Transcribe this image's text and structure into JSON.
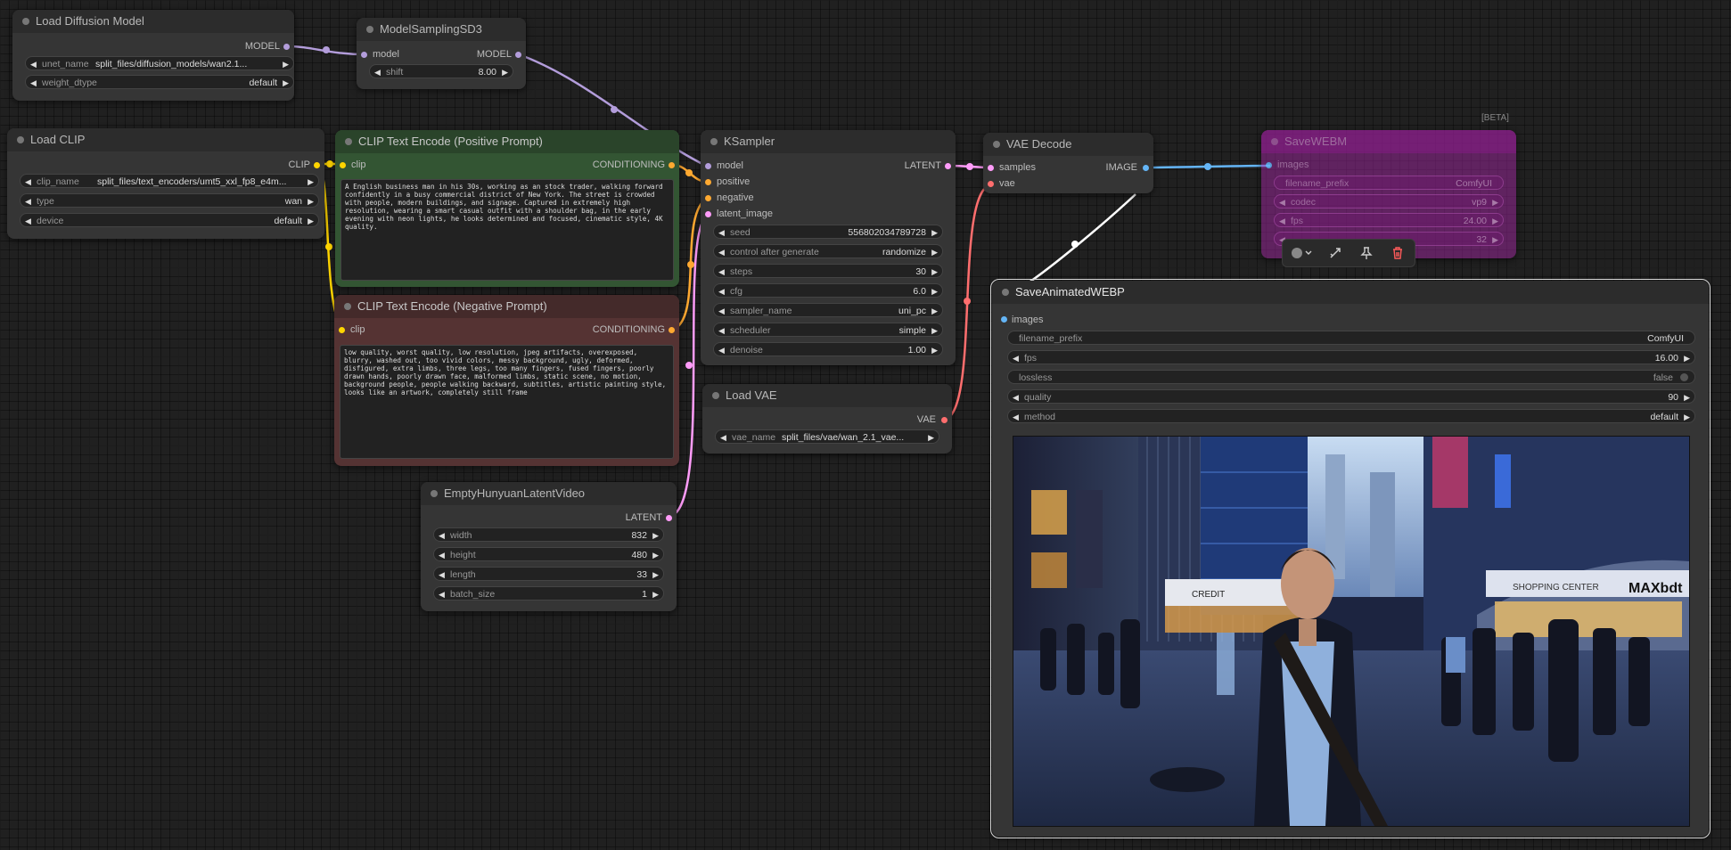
{
  "colors": {
    "model": "#b39ddb",
    "clip": "#ffd500",
    "conditioning": "#ffa931",
    "latent": "#ff9cf9",
    "vae": "#ff6e6e",
    "image": "#64b5f6"
  },
  "nodes": {
    "load_diffusion_model": {
      "title": "Load Diffusion Model",
      "out_model": "MODEL",
      "unet_name_label": "unet_name",
      "unet_name_value": "split_files/diffusion_models/wan2.1...",
      "weight_dtype_label": "weight_dtype",
      "weight_dtype_value": "default"
    },
    "model_sampling": {
      "title": "ModelSamplingSD3",
      "in_model": "model",
      "out_model": "MODEL",
      "shift_label": "shift",
      "shift_value": "8.00"
    },
    "load_clip": {
      "title": "Load CLIP",
      "out_clip": "CLIP",
      "clip_name_label": "clip_name",
      "clip_name_value": "split_files/text_encoders/umt5_xxl_fp8_e4m...",
      "type_label": "type",
      "type_value": "wan",
      "device_label": "device",
      "device_value": "default"
    },
    "clip_positive": {
      "title": "CLIP Text Encode (Positive Prompt)",
      "in_clip": "clip",
      "out": "CONDITIONING",
      "text": "A English business man in his 30s, working as an stock trader, walking forward confidently in a busy commercial district of New York. The street is crowded with people, modern buildings, and signage. Captured in extremely high resolution, wearing a smart casual outfit with a shoulder bag, in the early evening with neon lights, he looks determined and focused, cinematic style, 4K quality."
    },
    "clip_negative": {
      "title": "CLIP Text Encode (Negative Prompt)",
      "in_clip": "clip",
      "out": "CONDITIONING",
      "text": "low quality, worst quality, low resolution, jpeg artifacts, overexposed, blurry, washed out, too vivid colors, messy background, ugly, deformed, disfigured, extra limbs, three legs, too many fingers, fused fingers, poorly drawn hands, poorly drawn face, malformed limbs, static scene, no motion, background people, people walking backward, subtitles, artistic painting style, looks like an artwork, completely still frame"
    },
    "ksampler": {
      "title": "KSampler",
      "in_model": "model",
      "in_positive": "positive",
      "in_negative": "negative",
      "in_latent": "latent_image",
      "out": "LATENT",
      "widgets": [
        {
          "label": "seed",
          "value": "556802034789728"
        },
        {
          "label": "control after generate",
          "value": "randomize"
        },
        {
          "label": "steps",
          "value": "30"
        },
        {
          "label": "cfg",
          "value": "6.0"
        },
        {
          "label": "sampler_name",
          "value": "uni_pc"
        },
        {
          "label": "scheduler",
          "value": "simple"
        },
        {
          "label": "denoise",
          "value": "1.00"
        }
      ]
    },
    "vae_decode": {
      "title": "VAE Decode",
      "in_samples": "samples",
      "in_vae": "vae",
      "out": "IMAGE"
    },
    "load_vae": {
      "title": "Load VAE",
      "out": "VAE",
      "vae_name_label": "vae_name",
      "vae_name_value": "split_files/vae/wan_2.1_vae..."
    },
    "empty_latent": {
      "title": "EmptyHunyuanLatentVideo",
      "out": "LATENT",
      "widgets": [
        {
          "label": "width",
          "value": "832"
        },
        {
          "label": "height",
          "value": "480"
        },
        {
          "label": "length",
          "value": "33"
        },
        {
          "label": "batch_size",
          "value": "1"
        }
      ]
    },
    "save_webm": {
      "title": "SaveWEBM",
      "beta": "[BETA]",
      "in_images": "images",
      "filename_prefix_label": "filename_prefix",
      "filename_prefix_value": "ComfyUI",
      "codec_label": "codec",
      "codec_value": "vp9",
      "fps_label": "fps",
      "fps_value": "24.00",
      "crf_value": "32"
    },
    "save_webp": {
      "title": "SaveAnimatedWEBP",
      "in_images": "images",
      "filename_prefix_label": "filename_prefix",
      "filename_prefix_value": "ComfyUI",
      "fps_label": "fps",
      "fps_value": "16.00",
      "lossless_label": "lossless",
      "lossless_value": "false",
      "quality_label": "quality",
      "quality_value": "90",
      "method_label": "method",
      "method_value": "default"
    }
  },
  "preview_signs": {
    "sign_left": "CREDIT",
    "sign_right": "SHOPPING CENTER",
    "sign_brand": "MAXbdt"
  },
  "toolbar": {
    "color_icon": "color-circle-icon",
    "bypass_icon": "bypass-icon",
    "pin_icon": "pin-icon",
    "delete_icon": "trash-icon"
  }
}
